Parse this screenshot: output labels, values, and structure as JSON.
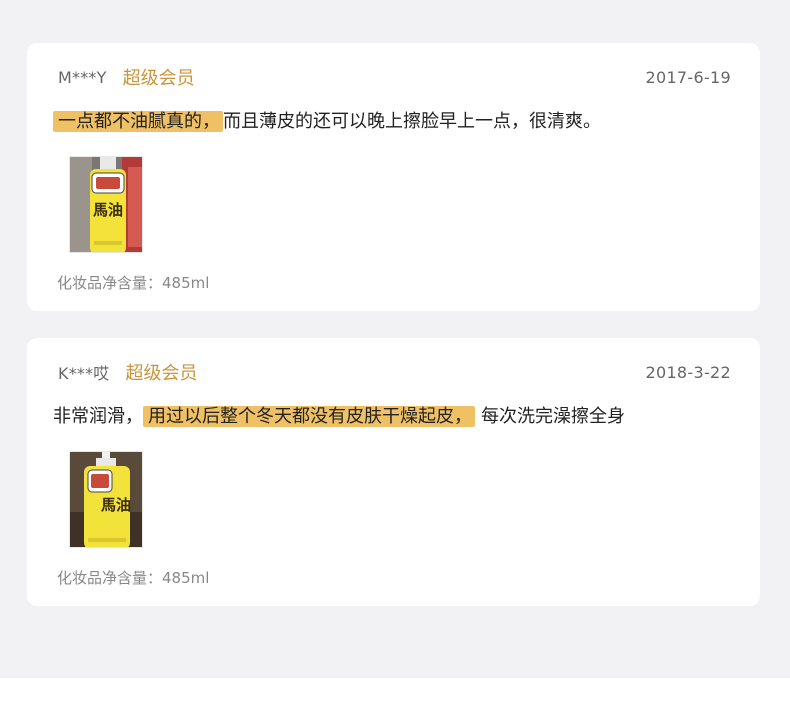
{
  "reviews": [
    {
      "username": "M***Y",
      "badge": "超级会员",
      "date": "2017-6-19",
      "text_highlight": "一点都不油腻真的，",
      "text_rest": "而且薄皮的还可以晚上擦脸早上一点，很清爽。",
      "photo_icon": "horse-oil-bottle-photo",
      "photo_text": "馬油",
      "spec": "化妆品净含量：485ml"
    },
    {
      "username": "K***哎",
      "badge": "超级会员",
      "date": "2018-3-22",
      "text_before": "非常润滑，",
      "text_highlight": "用过以后整个冬天都没有皮肤干燥起皮，",
      "text_rest": "每次洗完澡擦全身",
      "photo_icon": "horse-oil-bottle-photo",
      "photo_text": "馬油",
      "spec": "化妆品净含量：485ml"
    }
  ],
  "colors": {
    "page_bg": "#f2f2f4",
    "card_bg": "#ffffff",
    "badge": "#c9953c",
    "highlight": "#f0c065",
    "bottle_yellow": "#f2e23a"
  }
}
